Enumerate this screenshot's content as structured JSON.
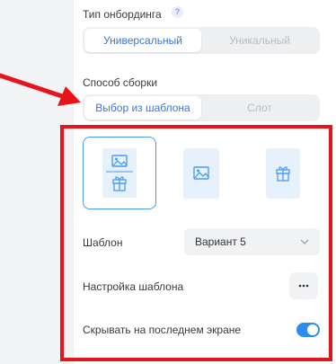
{
  "onboarding": {
    "title": "Тип онбординга",
    "options": [
      "Универсальный",
      "Уникальный"
    ],
    "selected": "Универсальный"
  },
  "assembly": {
    "title": "Способ сборки",
    "options": [
      "Выбор из шаблона",
      "Слот"
    ],
    "selected": "Выбор из шаблона"
  },
  "layouts": {
    "items": [
      "image-with-gift",
      "image",
      "gift"
    ],
    "selected": "image-with-gift"
  },
  "template": {
    "label": "Шаблон",
    "value": "Вариант 5"
  },
  "template_settings": {
    "label": "Настройка шаблона",
    "button_glyph": "···"
  },
  "hide_last": {
    "label": "Скрывать на последнем экране",
    "enabled": true
  },
  "colors": {
    "accent": "#3c74d8",
    "toggle": "#2d8cf0",
    "annotation_red": "#e8141c"
  }
}
